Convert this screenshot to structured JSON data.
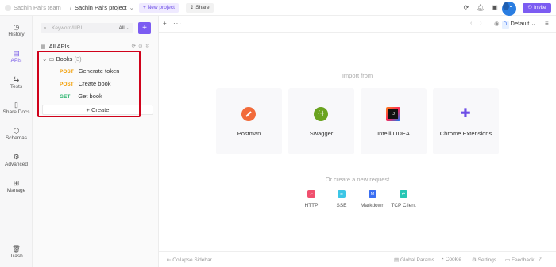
{
  "topbar": {
    "team": "Sachin Pal's team",
    "separator": "/",
    "project": "Sachin Pal's project",
    "new_project": "New project",
    "share": "Share",
    "invite": "Invite"
  },
  "rail": {
    "items": [
      {
        "label": "History",
        "icon": "clock-icon",
        "glyph": "◷"
      },
      {
        "label": "APIs",
        "icon": "api-icon",
        "glyph": "▤"
      },
      {
        "label": "Tests",
        "icon": "tests-icon",
        "glyph": "⇆"
      },
      {
        "label": "Share Docs",
        "icon": "docs-icon",
        "glyph": "▯"
      },
      {
        "label": "Schemas",
        "icon": "schema-icon",
        "glyph": "⬡"
      },
      {
        "label": "Advanced",
        "icon": "advanced-icon",
        "glyph": "⚙"
      },
      {
        "label": "Manage",
        "icon": "manage-icon",
        "glyph": "⊞"
      },
      {
        "label": "Trash",
        "icon": "trash-icon",
        "glyph": "🗑"
      }
    ]
  },
  "panel": {
    "search_placeholder": "Keyword/URL",
    "filter_value": "All",
    "all_apis": "All APIs",
    "folder": {
      "name": "Books",
      "count": "(3)"
    },
    "endpoints": [
      {
        "method": "POST",
        "name": "Generate token"
      },
      {
        "method": "POST",
        "name": "Create book"
      },
      {
        "method": "GET",
        "name": "Get book"
      }
    ],
    "create": "Create"
  },
  "main": {
    "environment": "Default",
    "env_badge": "D",
    "import_title": "Import from",
    "import_cards": [
      {
        "label": "Postman",
        "color": "#f26b3a",
        "icon": "postman-icon"
      },
      {
        "label": "Swagger",
        "color": "#6aa31f",
        "icon": "swagger-icon"
      },
      {
        "label": "IntelliJ IDEA",
        "color": "#111111",
        "icon": "intellij-icon"
      },
      {
        "label": "Chrome Extensions",
        "color": "#6d4ee6",
        "icon": "puzzle-icon"
      }
    ],
    "or_text": "Or create a new request",
    "requests": [
      {
        "label": "HTTP",
        "color": "#f0506e"
      },
      {
        "label": "SSE",
        "color": "#3cc6e6"
      },
      {
        "label": "Markdown",
        "color": "#3a6ff2"
      },
      {
        "label": "TCP Client",
        "color": "#26c6b4"
      }
    ]
  },
  "footer": {
    "collapse": "Collapse Sidebar",
    "global_params": "Global Params",
    "cookie": "Cookie",
    "settings": "Settings",
    "feedback": "Feedback"
  }
}
